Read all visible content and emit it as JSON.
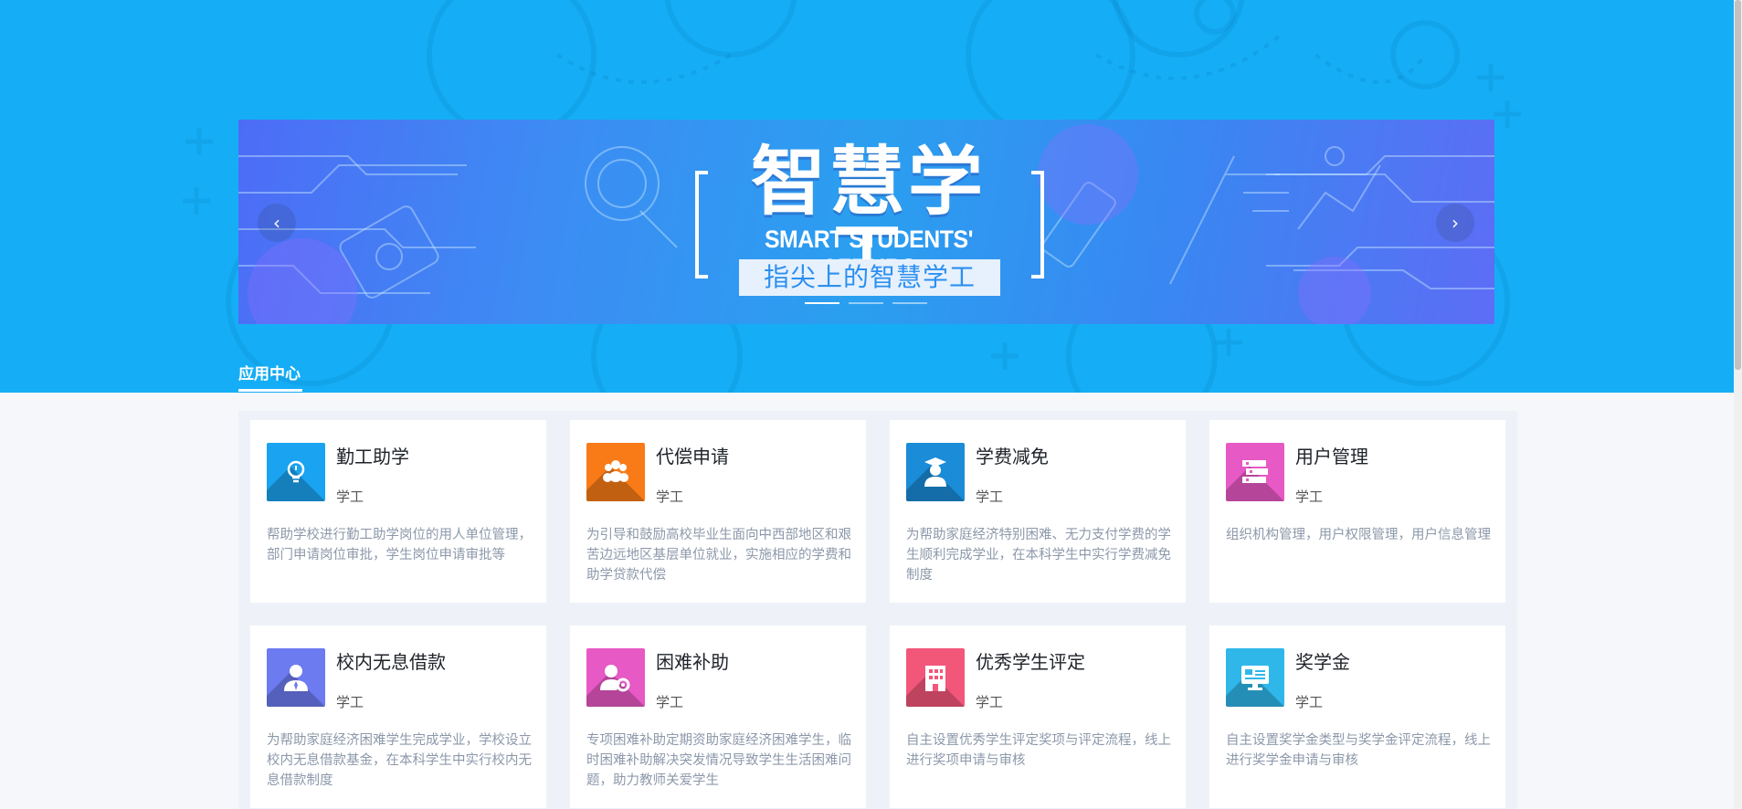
{
  "banner": {
    "title": "智慧学工",
    "subtitle": "SMART STUDENTS' AFFAIRS",
    "tagline": "指尖上的智慧学工",
    "prev_arrow": "‹",
    "next_arrow": "›",
    "slide_count": 3,
    "active_slide": 1
  },
  "section": {
    "tab_label": "应用中心"
  },
  "colors": {
    "hero_bg": "#15aef6",
    "accent": "#ffffff"
  },
  "apps": [
    {
      "title": "勤工助学",
      "tag": "学工",
      "desc": "帮助学校进行勤工助学岗位的用人单位管理，部门申请岗位审批，学生岗位申请审批等",
      "icon": "lightbulb-icon",
      "color": "#1aa3f0"
    },
    {
      "title": "代偿申请",
      "tag": "学工",
      "desc": "为引导和鼓励高校毕业生面向中西部地区和艰苦边远地区基层单位就业，实施相应的学费和助学贷款代偿",
      "icon": "group-icon",
      "color": "#f97b17"
    },
    {
      "title": "学费减免",
      "tag": "学工",
      "desc": "为帮助家庭经济特别困难、无力支付学费的学生顺利完成学业，在本科学生中实行学费减免制度",
      "icon": "graduate-icon",
      "color": "#1a8cd8"
    },
    {
      "title": "用户管理",
      "tag": "学工",
      "desc": "组织机构管理，用户权限管理，用户信息管理",
      "icon": "books-icon",
      "color": "#e759c4"
    },
    {
      "title": "校内无息借款",
      "tag": "学工",
      "desc": "为帮助家庭经济困难学生完成学业，学校设立校内无息借款基金，在本科学生中实行校内无息借款制度",
      "icon": "user-tie-icon",
      "color": "#6c7bf0"
    },
    {
      "title": "困难补助",
      "tag": "学工",
      "desc": "专项困难补助定期资助家庭经济困难学生，临时困难补助解决突发情况导致学生生活困难问题，助力教师关爱学生",
      "icon": "user-gear-icon",
      "color": "#e759c4"
    },
    {
      "title": "优秀学生评定",
      "tag": "学工",
      "desc": "自主设置优秀学生评定奖项与评定流程，线上进行奖项申请与审核",
      "icon": "building-icon",
      "color": "#f2577a"
    },
    {
      "title": "奖学金",
      "tag": "学工",
      "desc": "自主设置奖学金类型与奖学金评定流程，线上进行奖学金申请与审核",
      "icon": "monitor-icon",
      "color": "#2fb7ea"
    }
  ]
}
